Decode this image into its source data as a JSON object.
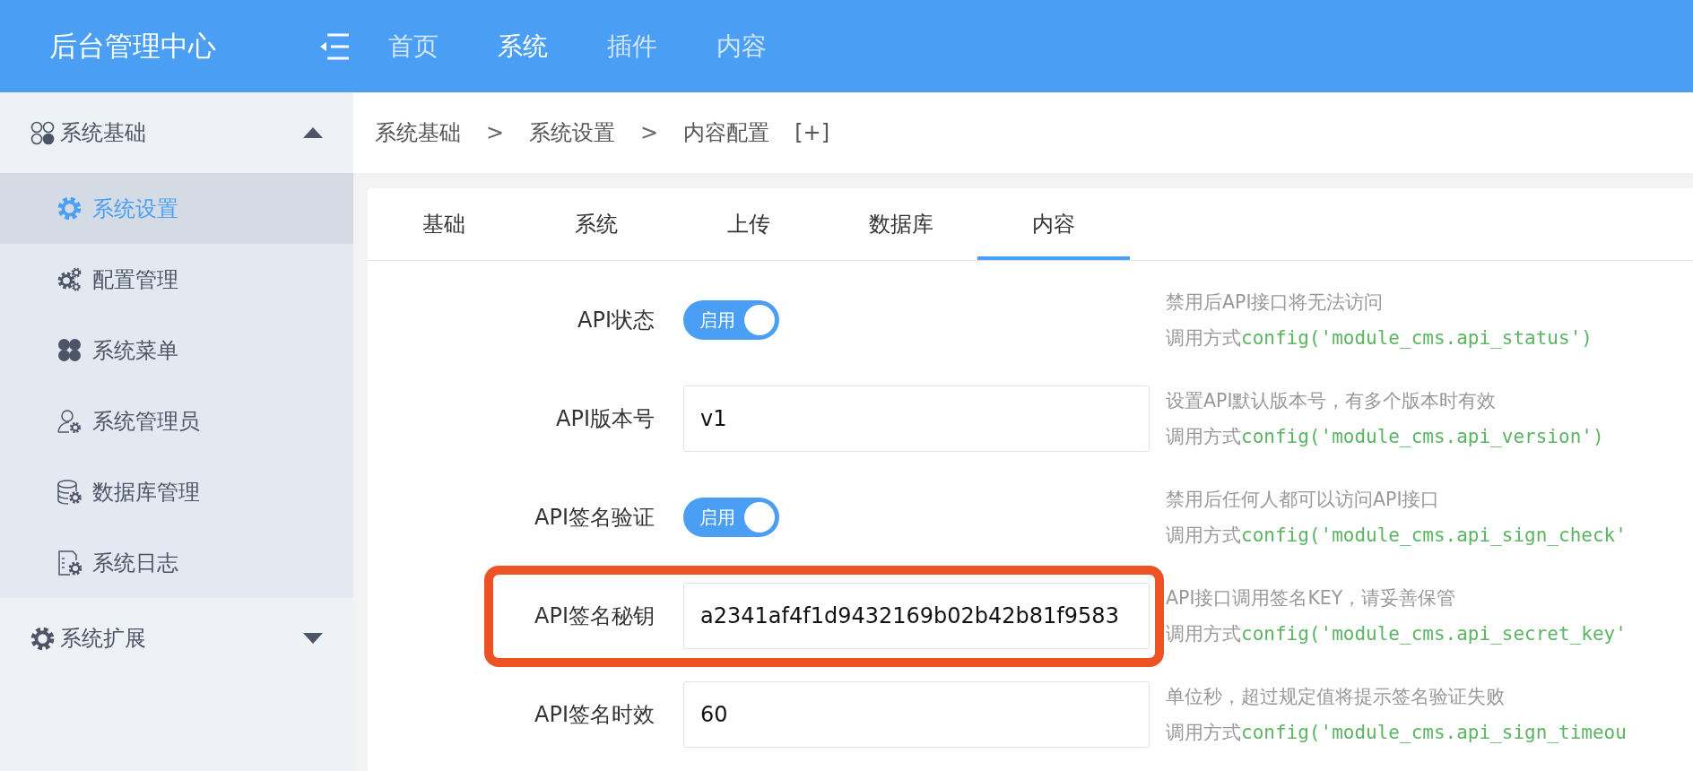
{
  "header": {
    "title": "后台管理中心",
    "nav": [
      {
        "label": "首页",
        "selected": false
      },
      {
        "label": "系统",
        "selected": true
      },
      {
        "label": "插件",
        "selected": false
      },
      {
        "label": "内容",
        "selected": false
      }
    ]
  },
  "sidebar": {
    "groups": [
      {
        "label": "系统基础",
        "expanded": true,
        "items": [
          {
            "label": "系统设置",
            "selected": true
          },
          {
            "label": "配置管理",
            "selected": false
          },
          {
            "label": "系统菜单",
            "selected": false
          },
          {
            "label": "系统管理员",
            "selected": false
          },
          {
            "label": "数据库管理",
            "selected": false
          },
          {
            "label": "系统日志",
            "selected": false
          }
        ]
      },
      {
        "label": "系统扩展",
        "expanded": false
      }
    ]
  },
  "breadcrumb": [
    {
      "kind": "crumb",
      "text": "系统基础"
    },
    {
      "kind": "separator",
      "text": ">"
    },
    {
      "kind": "crumb",
      "text": "系统设置"
    },
    {
      "kind": "separator",
      "text": ">"
    },
    {
      "kind": "crumb",
      "text": "内容配置"
    },
    {
      "kind": "action",
      "text": "[+]"
    }
  ],
  "tabs": [
    {
      "label": "基础",
      "selected": false
    },
    {
      "label": "系统",
      "selected": false
    },
    {
      "label": "上传",
      "selected": false
    },
    {
      "label": "数据库",
      "selected": false
    },
    {
      "label": "内容",
      "selected": true
    }
  ],
  "fields": [
    {
      "kind": "switch",
      "label": "API状态",
      "on": true,
      "switch_text": "启用",
      "help": "禁用后API接口将无法访问",
      "call_prefix": "调用方式",
      "code": "config('module_cms.api_status')",
      "highlighted": false
    },
    {
      "kind": "text",
      "label": "API版本号",
      "value": "v1",
      "help": "设置API默认版本号，有多个版本时有效",
      "call_prefix": "调用方式",
      "code": "config('module_cms.api_version')",
      "highlighted": false
    },
    {
      "kind": "switch",
      "label": "API签名验证",
      "on": true,
      "switch_text": "启用",
      "help": "禁用后任何人都可以访问API接口",
      "call_prefix": "调用方式",
      "code": "config('module_cms.api_sign_check'",
      "highlighted": false
    },
    {
      "kind": "text",
      "label": "API签名秘钥",
      "value": "a2341af4f1d9432169b02b42b81f9583",
      "help": "API接口调用签名KEY，请妥善保管",
      "call_prefix": "调用方式",
      "code": "config('module_cms.api_secret_key'",
      "highlighted": true
    },
    {
      "kind": "text",
      "label": "API签名时效",
      "value": "60",
      "help": "单位秒，超过规定值将提示签名验证失败",
      "call_prefix": "调用方式",
      "code": "config('module_cms.api_sign_timeou",
      "highlighted": false
    }
  ]
}
